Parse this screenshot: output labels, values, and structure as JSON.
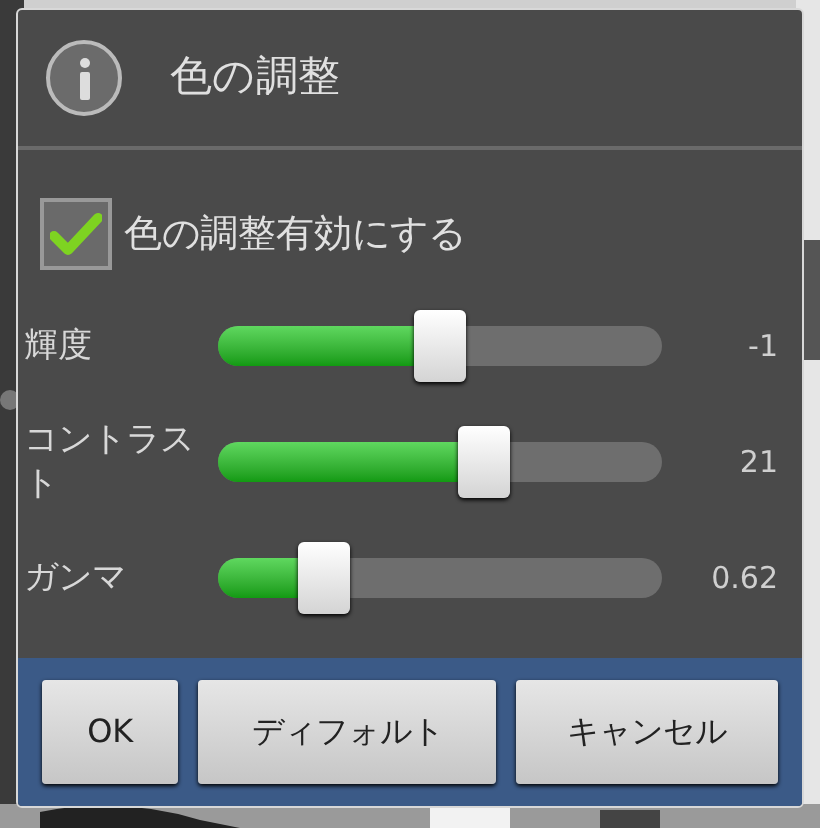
{
  "dialog": {
    "title": "色の調整"
  },
  "checkbox": {
    "label": "色の調整有効にする",
    "checked": true
  },
  "sliders": [
    {
      "label": "輝度",
      "level": 0.5,
      "reading": "-1"
    },
    {
      "label": "コントラスト",
      "level": 0.6,
      "reading": "21"
    },
    {
      "label": "ガンマ",
      "level": 0.24,
      "reading": "0.62"
    }
  ],
  "buttons": [
    "OK",
    "ディフォルト",
    "キャンセル"
  ]
}
